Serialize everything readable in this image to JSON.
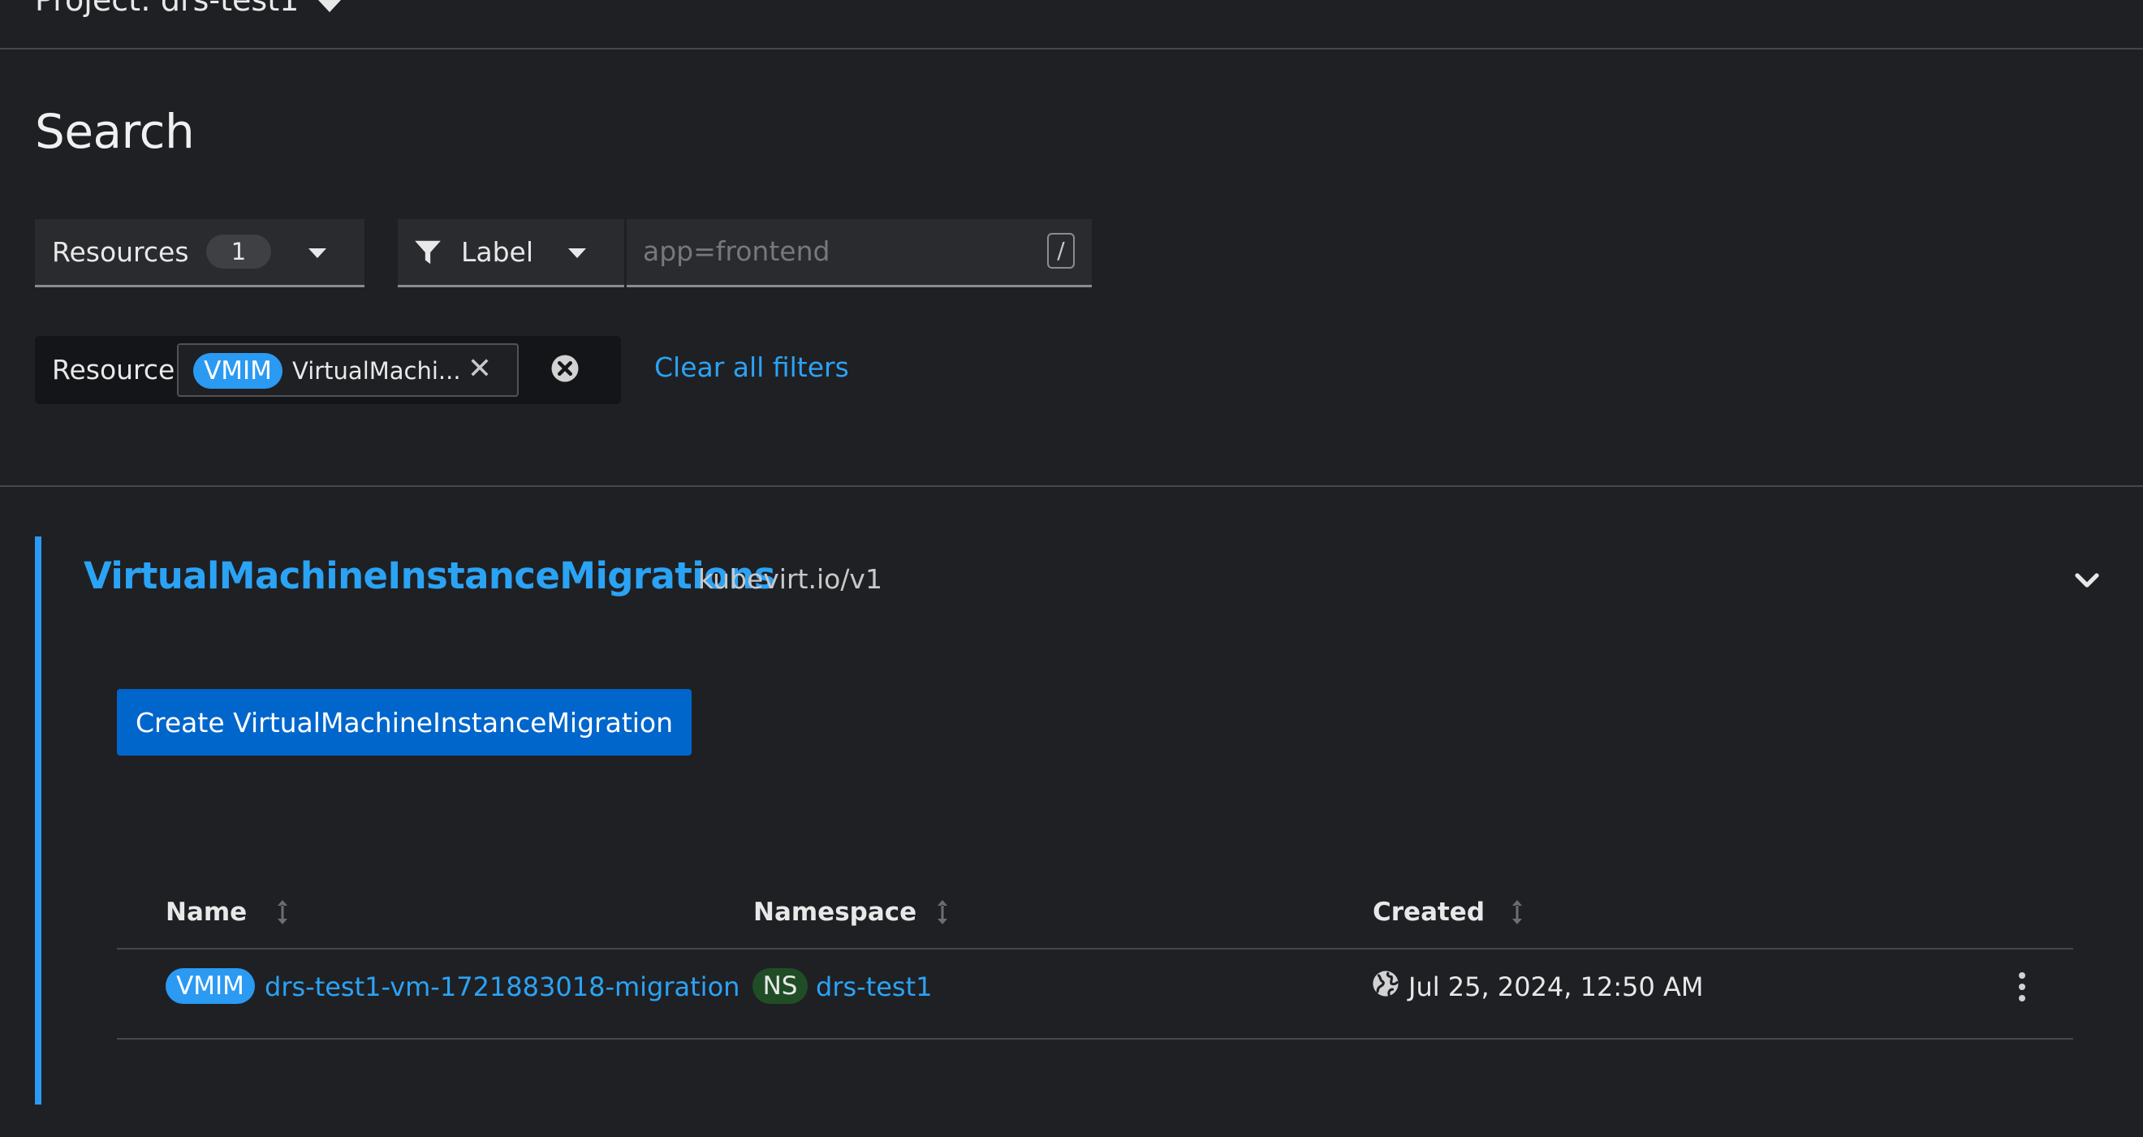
{
  "project": {
    "label": "Project: drs-test1"
  },
  "page": {
    "title": "Search"
  },
  "toolbar": {
    "resources_label": "Resources",
    "resources_count": "1",
    "label_filter": "Label",
    "label_placeholder": "app=frontend",
    "slash_key": "/"
  },
  "filters": {
    "category": "Resource",
    "chip_badge": "VMIM",
    "chip_text": "VirtualMachi...",
    "clear_all": "Clear all filters"
  },
  "section": {
    "title": "VirtualMachineInstanceMigrations",
    "version": "kubevirt.io/v1",
    "create_button": "Create VirtualMachineInstanceMigration"
  },
  "table": {
    "columns": [
      "Name",
      "Namespace",
      "Created"
    ],
    "rows": [
      {
        "kind_badge": "VMIM",
        "name": "drs-test1-vm-1721883018-migration",
        "ns_badge": "NS",
        "namespace": "drs-test1",
        "created": "Jul 25, 2024, 12:50 AM"
      }
    ]
  },
  "colors": {
    "background": "#1f2024",
    "link": "#2ba3f5",
    "primary_button": "#0066cc",
    "vmim_badge": "#2b9af3",
    "ns_badge": "#204d26"
  },
  "icons": [
    "chevron-down-icon",
    "filter-icon",
    "close-icon",
    "close-circle-icon",
    "sort-icon",
    "globe-icon",
    "kebab-icon"
  ]
}
